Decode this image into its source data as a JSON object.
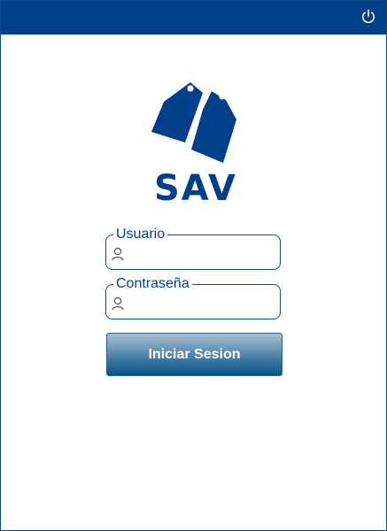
{
  "brand": {
    "name": "SAV"
  },
  "form": {
    "username_label": "Usuario",
    "username_value": "",
    "password_label": "Contraseña",
    "password_value": "",
    "submit_label": "Iniciar Sesion"
  },
  "icons": {
    "topbar": "power-icon",
    "username": "user-icon",
    "password": "user-icon",
    "logo": "price-tags-icon"
  },
  "colors": {
    "primary": "#003f8a",
    "button_top": "#a9c0d2",
    "button_bottom": "#0d5684",
    "background": "#ffffff"
  }
}
